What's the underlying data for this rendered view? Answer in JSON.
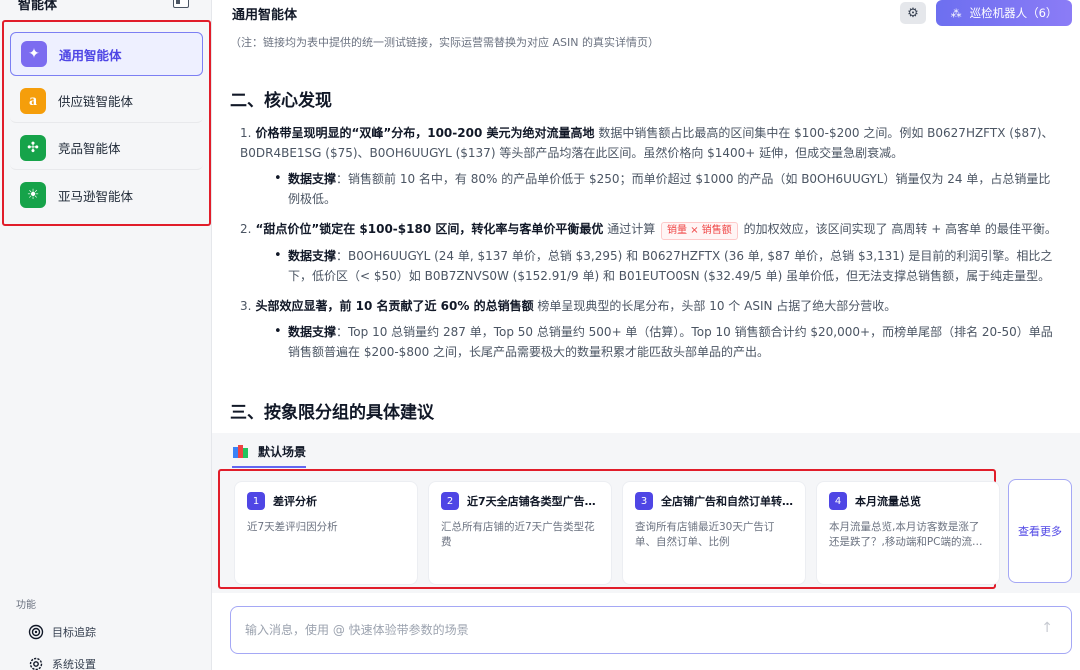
{
  "sidebar": {
    "title": "智能体",
    "agents": [
      {
        "label": "通用智能体",
        "icon": "sparkle-icon",
        "color": "#7c6cf0",
        "glyph": "✦"
      },
      {
        "label": "供应链智能体",
        "icon": "amazon-icon",
        "color": "#f59e0b",
        "glyph": "a"
      },
      {
        "label": "竞品智能体",
        "icon": "network-icon",
        "color": "#16a34a",
        "glyph": "✣"
      },
      {
        "label": "亚马逊智能体",
        "icon": "sun-icon",
        "color": "#16a34a",
        "glyph": "☀"
      }
    ],
    "section_label": "功能",
    "functions": [
      {
        "label": "目标追踪",
        "icon": "target-icon"
      },
      {
        "label": "系统设置",
        "icon": "gear-icon"
      }
    ]
  },
  "topbar": {
    "title": "通用智能体",
    "robot_button": "巡检机器人（6）"
  },
  "content": {
    "note": "（注：链接均为表中提供的统一测试链接，实际运营需替换为对应 ASIN 的真实详情页）",
    "section2_title": "二、核心发现",
    "findings": [
      {
        "num": "1.",
        "lead": "价格带呈现明显的“双峰”分布，100-200 美元为绝对流量高地",
        "text": " 数据中销售额占比最高的区间集中在 $100-$200 之间。例如 B0627HZFTX ($87)、B0DR4BE1SG ($75)、B0OH6UUGYL ($137) 等头部产品均落在此区间。虽然价格向 $1400+ 延伸，但成交量急剧衰减。",
        "sub_lead": "数据支撑",
        "sub_text": "：销售额前 10 名中，有 80% 的产品单价低于 $250；而单价超过 $1000 的产品（如 B0OH6UUGYL）销量仅为 24 单，占总销量比例极低。"
      },
      {
        "num": "2.",
        "lead": "“甜点价位”锁定在 $100-$180 区间，转化率与客单价平衡最优",
        "text_pre": " 通过计算 ",
        "chip": "销量 × 销售额",
        "text_post": " 的加权效应，该区间实现了 高周转 + 高客单 的最佳平衡。",
        "sub_lead": "数据支撑",
        "sub_text": "：B0OH6UUGYL (24 单, $137 单价，总销 $3,295) 和 B0627HZFTX (36 单, $87 单价，总销 $3,131) 是目前的利润引擎。相比之下，低价区（< $50）如 B0B7ZNVS0W ($152.91/9 单) 和 B01EUTO0SN ($32.49/5 单) 虽单价低，但无法支撑总销售额，属于纯走量型。"
      },
      {
        "num": "3.",
        "lead": "头部效应显著，前 10 名贡献了近 60% 的总销售额",
        "text": " 榜单呈现典型的长尾分布，头部 10 个 ASIN 占据了绝大部分营收。",
        "sub_lead": "数据支撑",
        "sub_text": "：Top 10 总销量约 287 单，Top 50 总销量约 500+ 单（估算）。Top 10 销售额合计约 $20,000+，而榜单尾部（排名 20-50）单品销售额普遍在 $200-$800 之间，长尾产品需要极大的数量积累才能匹敌头部单品的产出。"
      }
    ],
    "section3_title": "三、按象限分组的具体建议"
  },
  "scenes": {
    "tab_label": "默认场景",
    "cards": [
      {
        "num": "1",
        "title": "差评分析",
        "desc": "近7天差评归因分析"
      },
      {
        "num": "2",
        "title": "近7天全店铺各类型广告…",
        "desc": "汇总所有店铺的近7天广告类型花费"
      },
      {
        "num": "3",
        "title": "全店铺广告和自然订单转…",
        "desc": "查询所有店铺最近30天广告订单、自然订单、比例"
      },
      {
        "num": "4",
        "title": "本月流量总览",
        "desc": "本月流量总览,本月访客数是涨了还是跌了？,移动端和PC端的流…"
      }
    ],
    "more_label": "查看更多"
  },
  "input": {
    "placeholder": "输入消息，使用 @ 快速体验带参数的场景",
    "value": ""
  }
}
